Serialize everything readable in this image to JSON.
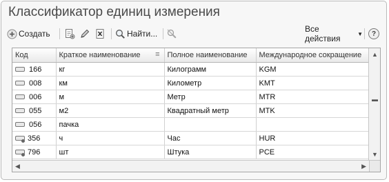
{
  "window": {
    "title": "Классификатор единиц измерения"
  },
  "toolbar": {
    "create_label": "Создать",
    "find_label": "Найти...",
    "all_actions_label": "Все действия",
    "help_label": "?"
  },
  "table": {
    "columns": [
      "Код",
      "Краткое наименование",
      "Полное наименование",
      "Международное сокращение"
    ],
    "sort_indicator": "≡",
    "rows": [
      {
        "code": "166",
        "short": "кг",
        "full": "Килограмм",
        "intl": "KGM",
        "icon": "element-icon"
      },
      {
        "code": "008",
        "short": "км",
        "full": "Километр",
        "intl": "KMT",
        "icon": "element-icon"
      },
      {
        "code": "006",
        "short": "м",
        "full": "Метр",
        "intl": "MTR",
        "icon": "element-icon"
      },
      {
        "code": "055",
        "short": "м2",
        "full": "Квадратный метр",
        "intl": "MTK",
        "icon": "element-icon"
      },
      {
        "code": "056",
        "short": "пачка",
        "full": "",
        "intl": "",
        "icon": "element-icon"
      },
      {
        "code": "356",
        "short": "ч",
        "full": "Час",
        "intl": "HUR",
        "icon": "element-predefined-icon"
      },
      {
        "code": "796",
        "short": "шт",
        "full": "Штука",
        "intl": "PCE",
        "icon": "element-predefined-icon"
      }
    ]
  },
  "colors": {
    "title": "#4a4a4a",
    "border": "#a5a5a5",
    "header_bg": "#efefef"
  }
}
